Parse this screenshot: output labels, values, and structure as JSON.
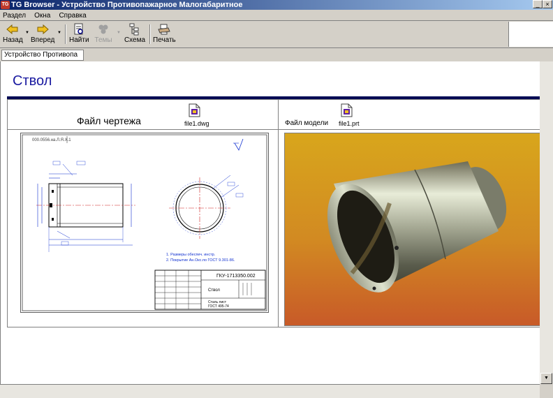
{
  "window": {
    "title": "TG Browser - Устройство Противопажарное Малогабаритное",
    "app_icon_text": "TG",
    "controls": {
      "minimize": "_",
      "close": "×"
    }
  },
  "menu": [
    "Раздел",
    "Окна",
    "Справка"
  ],
  "toolbar": {
    "back": "Назад",
    "forward": "Вперед",
    "find": "Найти",
    "themes": "Темы",
    "scheme": "Схема",
    "print": "Печать"
  },
  "tab": {
    "label": "Устройство Противопа"
  },
  "page": {
    "heading": "Ствол",
    "drawing": {
      "caption": "Файл чертежа",
      "file": "file1.dwg"
    },
    "model": {
      "caption": "Файл модели",
      "file": "file1.prt"
    }
  },
  "drawing_text": {
    "corner": "000.0556.на.Л.Я.Х.1",
    "note1": "1. Размеры обеспеч. инстр.",
    "note2": "2. Покрытие Ан.Окс.по ГОСТ 9.301-86.",
    "code": "ГКУ-1713350.002",
    "part": "Ствол",
    "material": "Сталь лист",
    "standard": "ГОСТ 495-74"
  },
  "colors": {
    "title_bar_start": "#0a246a",
    "title_bar_end": "#a6caf0",
    "heading": "#1a1aa0",
    "rule": "#000a54",
    "dimension": "#1030d0",
    "centerline": "#d02020",
    "render_bg_top": "#d8a61c",
    "render_bg_bottom": "#c85a28"
  },
  "scrollbar": {
    "down_arrow": "▼",
    "up_arrow": "▲"
  }
}
